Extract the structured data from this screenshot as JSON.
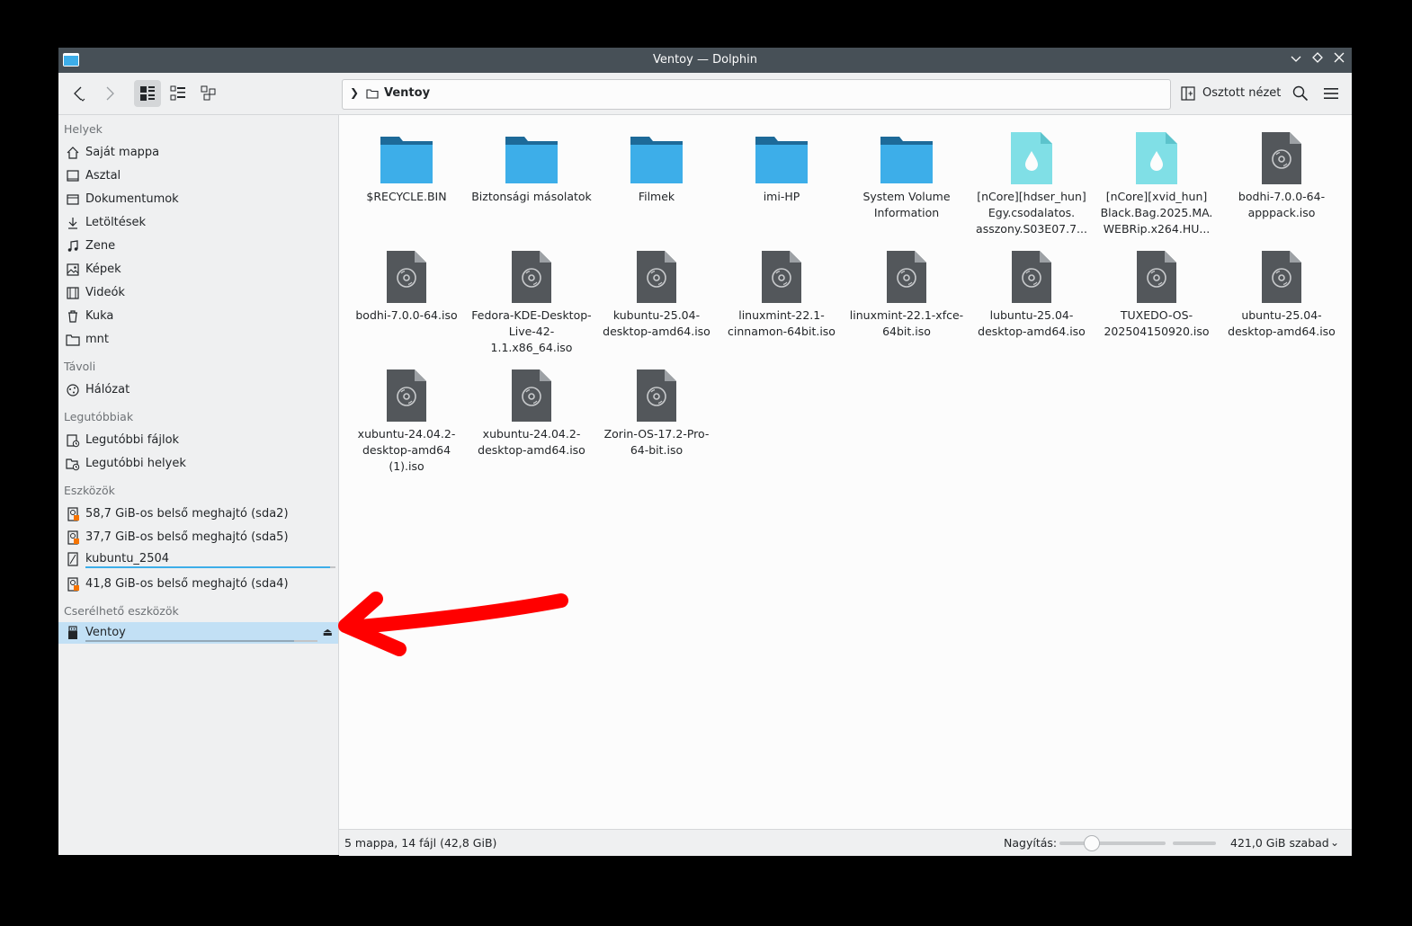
{
  "window": {
    "title": "Ventoy — Dolphin"
  },
  "toolbar": {
    "back": "Vissza",
    "forward": "Előre",
    "location": "Ventoy",
    "split_label": "Osztott nézet"
  },
  "sidebar": {
    "sections": {
      "places": "Helyek",
      "remote": "Távoli",
      "recent": "Legutóbbiak",
      "devices": "Eszközök",
      "removable": "Cserélhető eszközök"
    },
    "places": [
      {
        "label": "Saját mappa",
        "icon": "home-icon"
      },
      {
        "label": "Asztal",
        "icon": "desktop-icon"
      },
      {
        "label": "Dokumentumok",
        "icon": "documents-icon"
      },
      {
        "label": "Letöltések",
        "icon": "download-icon"
      },
      {
        "label": "Zene",
        "icon": "music-icon"
      },
      {
        "label": "Képek",
        "icon": "image-icon"
      },
      {
        "label": "Videók",
        "icon": "video-icon"
      },
      {
        "label": "Kuka",
        "icon": "trash-icon"
      },
      {
        "label": "mnt",
        "icon": "folder-icon"
      }
    ],
    "remote": [
      {
        "label": "Hálózat",
        "icon": "network-icon"
      }
    ],
    "recent": [
      {
        "label": "Legutóbbi fájlok",
        "icon": "recent-files-icon"
      },
      {
        "label": "Legutóbbi helyek",
        "icon": "recent-places-icon"
      }
    ],
    "devices": [
      {
        "label": "58,7 GiB-os belső meghajtó (sda2)",
        "icon": "drive-icon"
      },
      {
        "label": "37,7 GiB-os belső meghajtó (sda5)",
        "icon": "drive-icon"
      },
      {
        "label": "kubuntu_2504",
        "icon": "drive-mounted-icon",
        "usage": 0.98
      },
      {
        "label": "41,8 GiB-os belső meghajtó (sda4)",
        "icon": "drive-icon"
      }
    ],
    "removable": [
      {
        "label": "Ventoy",
        "icon": "usb-drive-icon",
        "usage": 0.9
      }
    ]
  },
  "files": [
    {
      "name": "$RECYCLE.BIN",
      "type": "folder"
    },
    {
      "name": "Biztonsági másolatok",
      "type": "folder"
    },
    {
      "name": "Filmek",
      "type": "folder"
    },
    {
      "name": "imi-HP",
      "type": "folder"
    },
    {
      "name": "System Volume Information",
      "type": "folder"
    },
    {
      "name": "[nCore][hdser_hun] Egy.csodalatos. asszony.S03E07.7...",
      "type": "video"
    },
    {
      "name": "[nCore][xvid_hun] Black.Bag.2025.MA. WEBRip.x264.HU...",
      "type": "video"
    },
    {
      "name": "bodhi-7.0.0-64-apppack.iso",
      "type": "iso"
    },
    {
      "name": "bodhi-7.0.0-64.iso",
      "type": "iso"
    },
    {
      "name": "Fedora-KDE-Desktop-Live-42-1.1.x86_64.iso",
      "type": "iso"
    },
    {
      "name": "kubuntu-25.04-desktop-amd64.iso",
      "type": "iso"
    },
    {
      "name": "linuxmint-22.1-cinnamon-64bit.iso",
      "type": "iso"
    },
    {
      "name": "linuxmint-22.1-xfce-64bit.iso",
      "type": "iso"
    },
    {
      "name": "lubuntu-25.04-desktop-amd64.iso",
      "type": "iso"
    },
    {
      "name": "TUXEDO-OS-202504150920.iso",
      "type": "iso"
    },
    {
      "name": "ubuntu-25.04-desktop-amd64.iso",
      "type": "iso"
    },
    {
      "name": "xubuntu-24.04.2-desktop-amd64 (1).iso",
      "type": "iso"
    },
    {
      "name": "xubuntu-24.04.2-desktop-amd64.iso",
      "type": "iso"
    },
    {
      "name": "Zorin-OS-17.2-Pro-64-bit.iso",
      "type": "iso"
    }
  ],
  "status": {
    "summary": "5 mappa, 14 fájl (42,8 GiB)",
    "zoom_label": "Nagyítás:",
    "zoom_level": 0.3,
    "free_space": "421,0 GiB szabad"
  },
  "colors": {
    "accent": "#3daee9",
    "selection": "#c2e0f5",
    "annotation": "#ff0000"
  }
}
